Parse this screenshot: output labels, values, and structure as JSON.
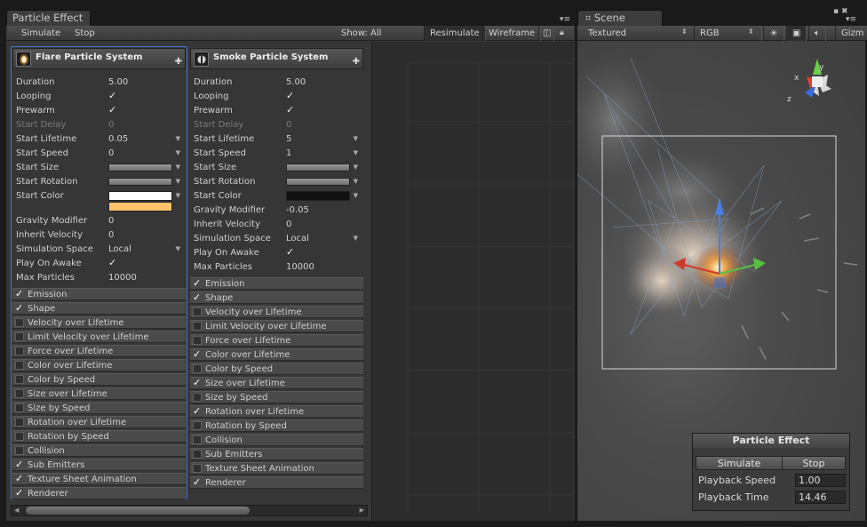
{
  "tabs": {
    "particle": "Particle Effect",
    "scene": "Scene"
  },
  "pe_toolbar": {
    "simulate": "Simulate",
    "stop": "Stop",
    "show": "Show: All",
    "resimulate": "Resimulate",
    "wireframe": "Wireframe"
  },
  "scene_toolbar": {
    "shading": "Textured",
    "render_mode": "RGB",
    "gizmos": "Gizm"
  },
  "gizmo_axes": {
    "x": "x",
    "y": "y",
    "z": "z"
  },
  "systems": [
    {
      "name": "Flare Particle System",
      "props": {
        "duration": {
          "label": "Duration",
          "value": "5.00"
        },
        "looping": {
          "label": "Looping",
          "check": "✓"
        },
        "prewarm": {
          "label": "Prewarm",
          "check": "✓"
        },
        "start_delay": {
          "label": "Start Delay",
          "value": "0"
        },
        "start_lifetime": {
          "label": "Start Lifetime",
          "value": "0.05"
        },
        "start_speed": {
          "label": "Start Speed",
          "value": "0"
        },
        "start_size": {
          "label": "Start Size"
        },
        "start_rotation": {
          "label": "Start Rotation"
        },
        "start_color": {
          "label": "Start Color"
        },
        "gravity_modifier": {
          "label": "Gravity Modifier",
          "value": "0"
        },
        "inherit_velocity": {
          "label": "Inherit Velocity",
          "value": "0"
        },
        "simulation_space": {
          "label": "Simulation Space",
          "value": "Local"
        },
        "play_on_awake": {
          "label": "Play On Awake",
          "check": "✓"
        },
        "max_particles": {
          "label": "Max Particles",
          "value": "10000"
        }
      },
      "modules": [
        {
          "label": "Emission",
          "on": "✓"
        },
        {
          "label": "Shape",
          "on": "✓"
        },
        {
          "label": "Velocity over Lifetime",
          "on": ""
        },
        {
          "label": "Limit Velocity over Lifetime",
          "on": ""
        },
        {
          "label": "Force over Lifetime",
          "on": ""
        },
        {
          "label": "Color over Lifetime",
          "on": ""
        },
        {
          "label": "Color by Speed",
          "on": ""
        },
        {
          "label": "Size over Lifetime",
          "on": ""
        },
        {
          "label": "Size by Speed",
          "on": ""
        },
        {
          "label": "Rotation over Lifetime",
          "on": ""
        },
        {
          "label": "Rotation by Speed",
          "on": ""
        },
        {
          "label": "Collision",
          "on": ""
        },
        {
          "label": "Sub Emitters",
          "on": "✓"
        },
        {
          "label": "Texture Sheet Animation",
          "on": "✓"
        },
        {
          "label": "Renderer",
          "on": "✓"
        }
      ]
    },
    {
      "name": "Smoke Particle System",
      "props": {
        "duration": {
          "label": "Duration",
          "value": "5.00"
        },
        "looping": {
          "label": "Looping",
          "check": "✓"
        },
        "prewarm": {
          "label": "Prewarm",
          "check": "✓"
        },
        "start_delay": {
          "label": "Start Delay",
          "value": "0"
        },
        "start_lifetime": {
          "label": "Start Lifetime",
          "value": "5"
        },
        "start_speed": {
          "label": "Start Speed",
          "value": "1"
        },
        "start_size": {
          "label": "Start Size"
        },
        "start_rotation": {
          "label": "Start Rotation"
        },
        "start_color": {
          "label": "Start Color"
        },
        "gravity_modifier": {
          "label": "Gravity Modifier",
          "value": "-0.05"
        },
        "inherit_velocity": {
          "label": "Inherit Velocity",
          "value": "0"
        },
        "simulation_space": {
          "label": "Simulation Space",
          "value": "Local"
        },
        "play_on_awake": {
          "label": "Play On Awake",
          "check": "✓"
        },
        "max_particles": {
          "label": "Max Particles",
          "value": "10000"
        }
      },
      "modules": [
        {
          "label": "Emission",
          "on": "✓"
        },
        {
          "label": "Shape",
          "on": "✓"
        },
        {
          "label": "Velocity over Lifetime",
          "on": ""
        },
        {
          "label": "Limit Velocity over Lifetime",
          "on": ""
        },
        {
          "label": "Force over Lifetime",
          "on": ""
        },
        {
          "label": "Color over Lifetime",
          "on": "✓"
        },
        {
          "label": "Color by Speed",
          "on": ""
        },
        {
          "label": "Size over Lifetime",
          "on": "✓"
        },
        {
          "label": "Size by Speed",
          "on": ""
        },
        {
          "label": "Rotation over Lifetime",
          "on": "✓"
        },
        {
          "label": "Rotation by Speed",
          "on": ""
        },
        {
          "label": "Collision",
          "on": ""
        },
        {
          "label": "Sub Emitters",
          "on": ""
        },
        {
          "label": "Texture Sheet Animation",
          "on": ""
        },
        {
          "label": "Renderer",
          "on": "✓"
        }
      ]
    }
  ],
  "overlay": {
    "title": "Particle Effect",
    "simulate": "Simulate",
    "stop": "Stop",
    "playback_speed_label": "Playback Speed",
    "playback_speed": "1.00",
    "playback_time_label": "Playback Time",
    "playback_time": "14.46"
  },
  "colors": {
    "selection": "#3d79d6",
    "flare_start_color_top": "#ffffff",
    "flare_start_color_bottom": "#ffc36a",
    "smoke_start_color": "#111111"
  }
}
